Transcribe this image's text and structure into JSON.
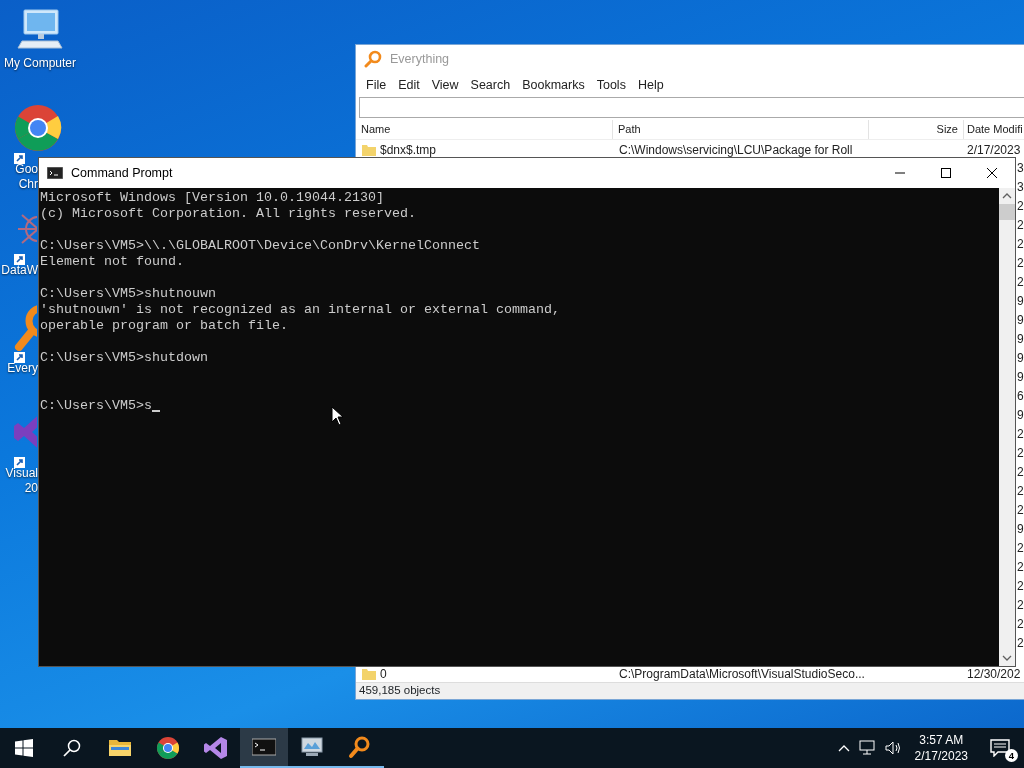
{
  "desktop_icons": [
    {
      "kind": "computer",
      "lines": [
        "My Computer"
      ],
      "shortcut": false
    },
    {
      "kind": "chrome",
      "lines": [
        "Goo",
        "Chr"
      ],
      "shortcut": true
    },
    {
      "kind": "network",
      "lines": [
        "DataW"
      ],
      "shortcut": true
    },
    {
      "kind": "everything",
      "lines": [
        "Every"
      ],
      "shortcut": true
    },
    {
      "kind": "studio",
      "lines": [
        "Visual",
        "20"
      ],
      "shortcut": true
    }
  ],
  "everything": {
    "title": "Everything",
    "menu": [
      "File",
      "Edit",
      "View",
      "Search",
      "Bookmarks",
      "Tools",
      "Help"
    ],
    "columns": [
      "Name",
      "Path",
      "Size",
      "Date Modifi"
    ],
    "rows": [
      {
        "kind": "full",
        "name": "$dnx$.tmp",
        "path": "C:\\Windows\\servicing\\LCU\\Package for Roll",
        "date": "2/17/2023"
      },
      {
        "kind": "covered",
        "date": "3"
      },
      {
        "kind": "covered",
        "date": "3"
      },
      {
        "kind": "covered",
        "date": "2"
      },
      {
        "kind": "covered",
        "date": "2"
      },
      {
        "kind": "covered",
        "date": "2"
      },
      {
        "kind": "covered",
        "date": "2"
      },
      {
        "kind": "covered",
        "date": "2"
      },
      {
        "kind": "covered",
        "date": "9"
      },
      {
        "kind": "covered",
        "date": "9"
      },
      {
        "kind": "covered",
        "date": "9"
      },
      {
        "kind": "covered",
        "date": "9"
      },
      {
        "kind": "covered",
        "date": "9"
      },
      {
        "kind": "covered",
        "date": "6"
      },
      {
        "kind": "covered",
        "date": "9"
      },
      {
        "kind": "covered",
        "date": "2"
      },
      {
        "kind": "covered",
        "date": "2"
      },
      {
        "kind": "covered",
        "date": "2"
      },
      {
        "kind": "covered",
        "date": "2"
      },
      {
        "kind": "covered",
        "date": "2"
      },
      {
        "kind": "covered",
        "date": "9"
      },
      {
        "kind": "covered",
        "date": "2"
      },
      {
        "kind": "covered",
        "date": "2"
      },
      {
        "kind": "covered",
        "date": "2"
      },
      {
        "kind": "covered",
        "date": "2"
      },
      {
        "kind": "covered",
        "date": "2"
      },
      {
        "kind": "covered",
        "date": "2"
      },
      {
        "kind": "full",
        "name": "0",
        "path": "C:\\ProgramData\\Microsoft\\VisualStudioSeco...",
        "date": "12/30/202"
      }
    ],
    "status": "459,185 objects"
  },
  "cmd": {
    "title": "Command Prompt",
    "blocks": [
      {
        "lines": [
          "Microsoft Windows [Version 10.0.19044.2130]",
          "(c) Microsoft Corporation. All rights reserved."
        ]
      },
      {
        "lines": [
          "C:\\Users\\VM5>\\\\.\\GLOBALROOT\\Device\\ConDrv\\KernelConnect",
          "Element not found."
        ]
      },
      {
        "lines": [
          "C:\\Users\\VM5>shutnouwn",
          "'shutnouwn' is not recognized as an internal or external command,",
          "operable program or batch file."
        ]
      },
      {
        "lines": [
          "C:\\Users\\VM5>shutdown"
        ]
      }
    ],
    "prompt": {
      "text": "C:\\Users\\VM5>s",
      "cursor": true
    }
  },
  "taskbar": {
    "apps": [
      {
        "kind": "folder",
        "running": false,
        "selected": false
      },
      {
        "kind": "chrome",
        "running": false,
        "selected": false
      },
      {
        "kind": "studio",
        "running": false,
        "selected": false
      },
      {
        "kind": "console",
        "running": true,
        "selected": true
      },
      {
        "kind": "monitor",
        "running": true,
        "selected": false
      },
      {
        "kind": "everything",
        "running": true,
        "selected": false
      }
    ],
    "time": "3:57 AM",
    "date": "2/17/2023",
    "notifications": "4"
  }
}
